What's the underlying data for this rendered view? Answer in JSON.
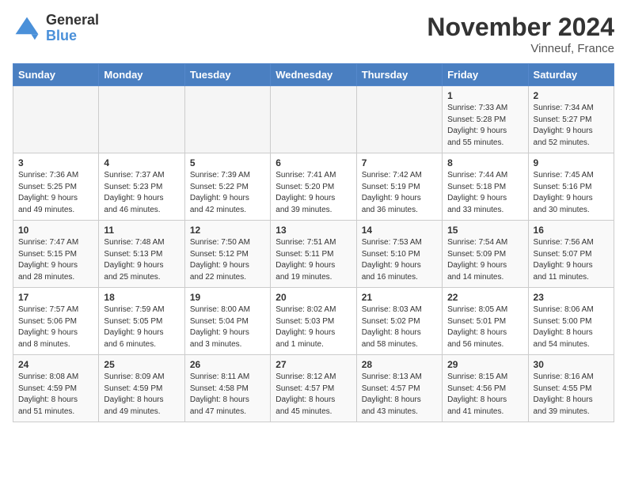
{
  "header": {
    "logo_general": "General",
    "logo_blue": "Blue",
    "month_title": "November 2024",
    "location": "Vinneuf, France"
  },
  "weekdays": [
    "Sunday",
    "Monday",
    "Tuesday",
    "Wednesday",
    "Thursday",
    "Friday",
    "Saturday"
  ],
  "weeks": [
    [
      {
        "day": "",
        "info": ""
      },
      {
        "day": "",
        "info": ""
      },
      {
        "day": "",
        "info": ""
      },
      {
        "day": "",
        "info": ""
      },
      {
        "day": "",
        "info": ""
      },
      {
        "day": "1",
        "info": "Sunrise: 7:33 AM\nSunset: 5:28 PM\nDaylight: 9 hours\nand 55 minutes."
      },
      {
        "day": "2",
        "info": "Sunrise: 7:34 AM\nSunset: 5:27 PM\nDaylight: 9 hours\nand 52 minutes."
      }
    ],
    [
      {
        "day": "3",
        "info": "Sunrise: 7:36 AM\nSunset: 5:25 PM\nDaylight: 9 hours\nand 49 minutes."
      },
      {
        "day": "4",
        "info": "Sunrise: 7:37 AM\nSunset: 5:23 PM\nDaylight: 9 hours\nand 46 minutes."
      },
      {
        "day": "5",
        "info": "Sunrise: 7:39 AM\nSunset: 5:22 PM\nDaylight: 9 hours\nand 42 minutes."
      },
      {
        "day": "6",
        "info": "Sunrise: 7:41 AM\nSunset: 5:20 PM\nDaylight: 9 hours\nand 39 minutes."
      },
      {
        "day": "7",
        "info": "Sunrise: 7:42 AM\nSunset: 5:19 PM\nDaylight: 9 hours\nand 36 minutes."
      },
      {
        "day": "8",
        "info": "Sunrise: 7:44 AM\nSunset: 5:18 PM\nDaylight: 9 hours\nand 33 minutes."
      },
      {
        "day": "9",
        "info": "Sunrise: 7:45 AM\nSunset: 5:16 PM\nDaylight: 9 hours\nand 30 minutes."
      }
    ],
    [
      {
        "day": "10",
        "info": "Sunrise: 7:47 AM\nSunset: 5:15 PM\nDaylight: 9 hours\nand 28 minutes."
      },
      {
        "day": "11",
        "info": "Sunrise: 7:48 AM\nSunset: 5:13 PM\nDaylight: 9 hours\nand 25 minutes."
      },
      {
        "day": "12",
        "info": "Sunrise: 7:50 AM\nSunset: 5:12 PM\nDaylight: 9 hours\nand 22 minutes."
      },
      {
        "day": "13",
        "info": "Sunrise: 7:51 AM\nSunset: 5:11 PM\nDaylight: 9 hours\nand 19 minutes."
      },
      {
        "day": "14",
        "info": "Sunrise: 7:53 AM\nSunset: 5:10 PM\nDaylight: 9 hours\nand 16 minutes."
      },
      {
        "day": "15",
        "info": "Sunrise: 7:54 AM\nSunset: 5:09 PM\nDaylight: 9 hours\nand 14 minutes."
      },
      {
        "day": "16",
        "info": "Sunrise: 7:56 AM\nSunset: 5:07 PM\nDaylight: 9 hours\nand 11 minutes."
      }
    ],
    [
      {
        "day": "17",
        "info": "Sunrise: 7:57 AM\nSunset: 5:06 PM\nDaylight: 9 hours\nand 8 minutes."
      },
      {
        "day": "18",
        "info": "Sunrise: 7:59 AM\nSunset: 5:05 PM\nDaylight: 9 hours\nand 6 minutes."
      },
      {
        "day": "19",
        "info": "Sunrise: 8:00 AM\nSunset: 5:04 PM\nDaylight: 9 hours\nand 3 minutes."
      },
      {
        "day": "20",
        "info": "Sunrise: 8:02 AM\nSunset: 5:03 PM\nDaylight: 9 hours\nand 1 minute."
      },
      {
        "day": "21",
        "info": "Sunrise: 8:03 AM\nSunset: 5:02 PM\nDaylight: 8 hours\nand 58 minutes."
      },
      {
        "day": "22",
        "info": "Sunrise: 8:05 AM\nSunset: 5:01 PM\nDaylight: 8 hours\nand 56 minutes."
      },
      {
        "day": "23",
        "info": "Sunrise: 8:06 AM\nSunset: 5:00 PM\nDaylight: 8 hours\nand 54 minutes."
      }
    ],
    [
      {
        "day": "24",
        "info": "Sunrise: 8:08 AM\nSunset: 4:59 PM\nDaylight: 8 hours\nand 51 minutes."
      },
      {
        "day": "25",
        "info": "Sunrise: 8:09 AM\nSunset: 4:59 PM\nDaylight: 8 hours\nand 49 minutes."
      },
      {
        "day": "26",
        "info": "Sunrise: 8:11 AM\nSunset: 4:58 PM\nDaylight: 8 hours\nand 47 minutes."
      },
      {
        "day": "27",
        "info": "Sunrise: 8:12 AM\nSunset: 4:57 PM\nDaylight: 8 hours\nand 45 minutes."
      },
      {
        "day": "28",
        "info": "Sunrise: 8:13 AM\nSunset: 4:57 PM\nDaylight: 8 hours\nand 43 minutes."
      },
      {
        "day": "29",
        "info": "Sunrise: 8:15 AM\nSunset: 4:56 PM\nDaylight: 8 hours\nand 41 minutes."
      },
      {
        "day": "30",
        "info": "Sunrise: 8:16 AM\nSunset: 4:55 PM\nDaylight: 8 hours\nand 39 minutes."
      }
    ]
  ]
}
